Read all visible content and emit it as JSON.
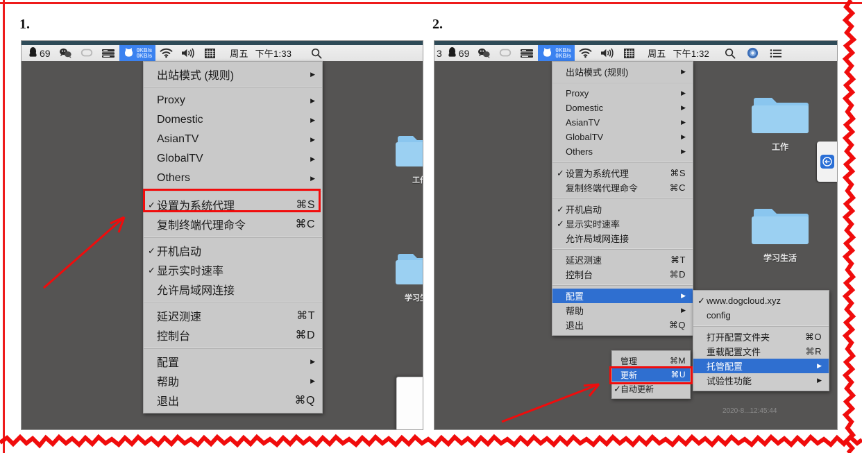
{
  "frame": {
    "color": "#ee1b1b"
  },
  "panels": [
    {
      "number": "1.",
      "menubar": {
        "icons": [
          {
            "name": "qq-penguin-icon",
            "label": "69"
          },
          {
            "name": "wechat-icon",
            "label": ""
          },
          {
            "name": "adobe-cc-icon",
            "label": ""
          },
          {
            "name": "istat-menus-icon",
            "label": ""
          }
        ],
        "clash": {
          "name": "clash-icon",
          "speed_up": "0KB/s",
          "speed_down": "0KB/s",
          "highlight_color": "#3b82f0"
        },
        "wifi": "wifi-icon",
        "volume": "volume-icon",
        "input_method": "pinyin-input-icon",
        "day": "周五",
        "time": "下午1:33",
        "search": "spotlight-search-icon"
      },
      "desktop": {
        "folders": [
          {
            "name": "folder-work",
            "label": "工作"
          },
          {
            "name": "folder-study-life",
            "label": "学习生活"
          }
        ]
      },
      "menu": {
        "items": [
          {
            "check": "",
            "label": "出站模式 (规则)",
            "key": "",
            "arrow": true
          },
          {
            "sep": true
          },
          {
            "check": "",
            "label": "Proxy",
            "key": "",
            "arrow": true
          },
          {
            "check": "",
            "label": "Domestic",
            "key": "",
            "arrow": true
          },
          {
            "check": "",
            "label": "AsianTV",
            "key": "",
            "arrow": true
          },
          {
            "check": "",
            "label": "GlobalTV",
            "key": "",
            "arrow": true
          },
          {
            "check": "",
            "label": "Others",
            "key": "",
            "arrow": true
          },
          {
            "sep": true
          },
          {
            "check": "✓",
            "label": "设置为系统代理",
            "key": "⌘S",
            "arrow": false
          },
          {
            "check": "",
            "label": "复制终端代理命令",
            "key": "⌘C",
            "arrow": false
          },
          {
            "sep": true
          },
          {
            "check": "✓",
            "label": "开机启动",
            "key": "",
            "arrow": false
          },
          {
            "check": "✓",
            "label": "显示实时速率",
            "key": "",
            "arrow": false
          },
          {
            "check": "",
            "label": "允许局域网连接",
            "key": "",
            "arrow": false
          },
          {
            "sep": true
          },
          {
            "check": "",
            "label": "延迟测速",
            "key": "⌘T",
            "arrow": false
          },
          {
            "check": "",
            "label": "控制台",
            "key": "⌘D",
            "arrow": false
          },
          {
            "sep": true
          },
          {
            "check": "",
            "label": "配置",
            "key": "",
            "arrow": true
          },
          {
            "check": "",
            "label": "帮助",
            "key": "",
            "arrow": true
          },
          {
            "check": "",
            "label": "退出",
            "key": "⌘Q",
            "arrow": false
          }
        ]
      },
      "annotation": {
        "box_target": "设置为系统代理",
        "arrow": "red-arrow-up-right"
      }
    },
    {
      "number": "2.",
      "menubar": {
        "leading_text": "3",
        "icons": [
          {
            "name": "qq-penguin-icon",
            "label": "69"
          },
          {
            "name": "wechat-icon",
            "label": ""
          },
          {
            "name": "adobe-cc-icon",
            "label": ""
          },
          {
            "name": "istat-menus-icon",
            "label": ""
          }
        ],
        "clash": {
          "name": "clash-icon",
          "speed_up": "0KB/s",
          "speed_down": "0KB/s",
          "highlight_color": "#3b82f0"
        },
        "wifi": "wifi-icon",
        "volume": "volume-icon",
        "input_method": "pinyin-input-icon",
        "day": "周五",
        "time": "下午1:32",
        "search": "spotlight-search-icon",
        "siri": "siri-icon",
        "notification_center": "notification-center-icon"
      },
      "desktop": {
        "folders": [
          {
            "name": "folder-work",
            "label": "工作"
          },
          {
            "name": "folder-study-life",
            "label": "学习生活"
          }
        ],
        "timestamp_text": "2020-8...12:45:44"
      },
      "menu": {
        "items": [
          {
            "check": "",
            "label": "出站模式 (规则)",
            "key": "",
            "arrow": true
          },
          {
            "sep": true
          },
          {
            "check": "",
            "label": "Proxy",
            "key": "",
            "arrow": true
          },
          {
            "check": "",
            "label": "Domestic",
            "key": "",
            "arrow": true
          },
          {
            "check": "",
            "label": "AsianTV",
            "key": "",
            "arrow": true
          },
          {
            "check": "",
            "label": "GlobalTV",
            "key": "",
            "arrow": true
          },
          {
            "check": "",
            "label": "Others",
            "key": "",
            "arrow": true
          },
          {
            "sep": true
          },
          {
            "check": "✓",
            "label": "设置为系统代理",
            "key": "⌘S",
            "arrow": false
          },
          {
            "check": "",
            "label": "复制终端代理命令",
            "key": "⌘C",
            "arrow": false
          },
          {
            "sep": true
          },
          {
            "check": "✓",
            "label": "开机启动",
            "key": "",
            "arrow": false
          },
          {
            "check": "✓",
            "label": "显示实时速率",
            "key": "",
            "arrow": false
          },
          {
            "check": "",
            "label": "允许局域网连接",
            "key": "",
            "arrow": false
          },
          {
            "sep": true
          },
          {
            "check": "",
            "label": "延迟测速",
            "key": "⌘T",
            "arrow": false
          },
          {
            "check": "",
            "label": "控制台",
            "key": "⌘D",
            "arrow": false
          },
          {
            "sep": true
          },
          {
            "check": "",
            "label": "配置",
            "key": "",
            "arrow": true,
            "selected": true
          },
          {
            "check": "",
            "label": "帮助",
            "key": "",
            "arrow": true
          },
          {
            "check": "",
            "label": "退出",
            "key": "⌘Q",
            "arrow": false
          }
        ]
      },
      "submenu_config": {
        "items": [
          {
            "check": "✓",
            "label": "www.dogcloud.xyz",
            "key": "",
            "arrow": false
          },
          {
            "check": "",
            "label": "config",
            "key": "",
            "arrow": false
          },
          {
            "sep": true
          },
          {
            "check": "",
            "label": "打开配置文件夹",
            "key": "⌘O",
            "arrow": false
          },
          {
            "check": "",
            "label": "重载配置文件",
            "key": "⌘R",
            "arrow": false
          },
          {
            "check": "",
            "label": "托管配置",
            "key": "",
            "arrow": true,
            "selected": true
          },
          {
            "check": "",
            "label": "试验性功能",
            "key": "",
            "arrow": true
          }
        ]
      },
      "submenu_hosted": {
        "items": [
          {
            "check": "",
            "label": "管理",
            "key": "⌘M",
            "arrow": false
          },
          {
            "check": "",
            "label": "更新",
            "key": "⌘U",
            "arrow": false,
            "selected": true
          },
          {
            "check": "✓",
            "label": "自动更新",
            "key": "",
            "arrow": false
          }
        ]
      },
      "annotation": {
        "box_target": "更新",
        "arrow": "red-arrow-up-right"
      }
    }
  ]
}
